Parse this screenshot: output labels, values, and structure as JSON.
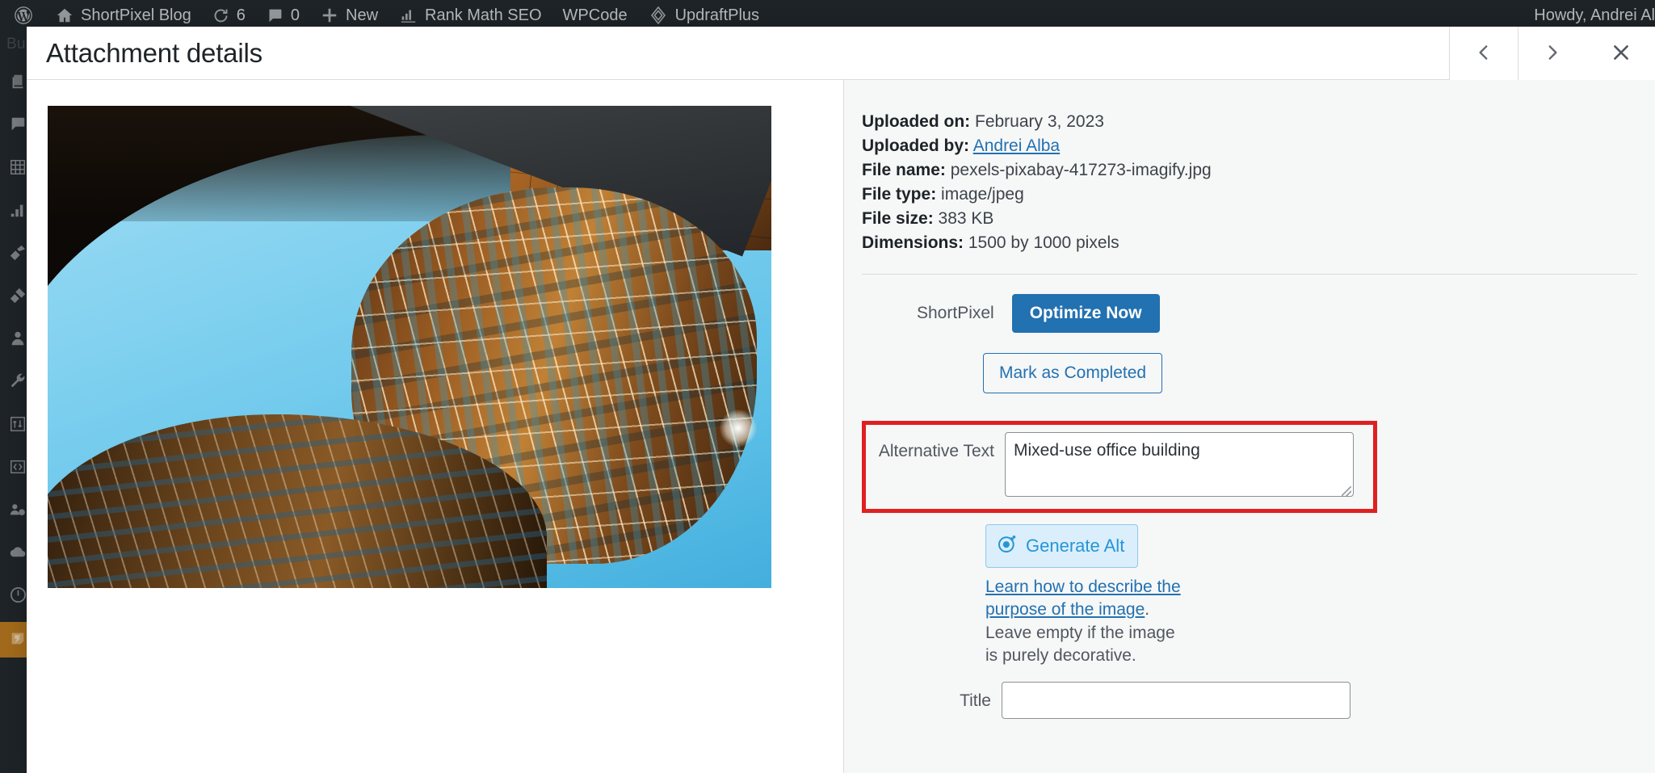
{
  "adminbar": {
    "logo_icon": "wordpress-logo-icon",
    "items": [
      {
        "icon": "home-icon",
        "label": "ShortPixel Blog"
      },
      {
        "icon": "updates-icon",
        "label": "6"
      },
      {
        "icon": "comments-icon",
        "label": "0"
      },
      {
        "icon": "plus-icon",
        "label": "New"
      },
      {
        "icon": "rank-math-icon",
        "label": "Rank Math SEO"
      },
      {
        "icon": "wpcode-icon",
        "label": "WPCode"
      },
      {
        "icon": "updraftplus-icon",
        "label": "UpdraftPlus"
      }
    ],
    "howdy": "Howdy, Andrei Al"
  },
  "adminmenu": {
    "collapsed_label": "Bul",
    "icons": [
      "pages-icon",
      "comments-icon",
      "media-grid-icon",
      "analytics-icon",
      "appearance-brush-icon",
      "plugins-plug-icon",
      "users-icon",
      "tools-wrench-icon",
      "settings-icon",
      "code-icon",
      "user-settings-icon",
      "cloud-icon",
      "power-icon",
      "shortpixel-icon"
    ]
  },
  "modal": {
    "title": "Attachment details",
    "prev_button": {
      "name": "previous-attachment",
      "glyph": "‹"
    },
    "next_button": {
      "name": "next-attachment",
      "glyph": "›"
    },
    "close_button": {
      "name": "close-modal",
      "glyph": "✕"
    }
  },
  "attachment": {
    "alt_description": "Mixed-use office building",
    "meta": [
      {
        "label": "Uploaded on:",
        "value": "February 3, 2023"
      },
      {
        "label": "Uploaded by:",
        "value": "Andrei Alba",
        "is_link": true
      },
      {
        "label": "File name:",
        "value": "pexels-pixabay-417273-imagify.jpg"
      },
      {
        "label": "File type:",
        "value": "image/jpeg"
      },
      {
        "label": "File size:",
        "value": "383 KB"
      },
      {
        "label": "Dimensions:",
        "value": "1500 by 1000 pixels"
      }
    ]
  },
  "shortpixel": {
    "label": "ShortPixel",
    "optimize_button": "Optimize Now",
    "mark_completed_button": "Mark as Completed",
    "accent_color": "#2271b1"
  },
  "alt_field": {
    "label": "Alternative Text",
    "value": "Mixed-use office building",
    "highlight_color": "#e02020",
    "generate_button": "Generate Alt",
    "generate_icon": "ai-badge-icon",
    "help_link": "Learn how to describe the purpose of the image",
    "help_rest": ". Leave empty if the image is purely decorative."
  },
  "title_field": {
    "label": "Title",
    "value": "",
    "placeholder": ""
  }
}
